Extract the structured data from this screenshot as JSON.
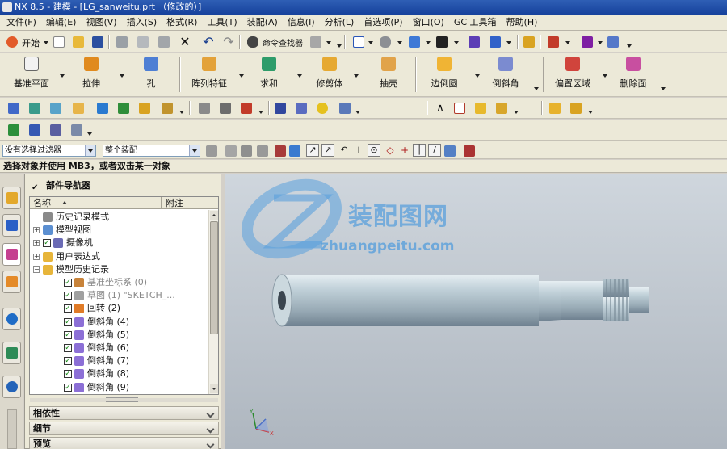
{
  "window": {
    "title": "NX 8.5 - 建模 - [LG_sanweitu.prt （修改的）]"
  },
  "menu": [
    "文件(F)",
    "编辑(E)",
    "视图(V)",
    "插入(S)",
    "格式(R)",
    "工具(T)",
    "装配(A)",
    "信息(I)",
    "分析(L)",
    "首选项(P)",
    "窗口(O)",
    "GC 工具箱",
    "帮助(H)"
  ],
  "standard_toolbar": {
    "start_label": "开始",
    "command_finder_label": "命令查找器"
  },
  "feature_toolbar": [
    {
      "label": "基准平面",
      "icon": "datum-plane-icon"
    },
    {
      "label": "拉伸",
      "icon": "extrude-icon"
    },
    {
      "label": "孔",
      "icon": "hole-icon"
    },
    {
      "label": "阵列特征",
      "icon": "pattern-feature-icon"
    },
    {
      "label": "求和",
      "icon": "unite-icon"
    },
    {
      "label": "修剪体",
      "icon": "trim-body-icon"
    },
    {
      "label": "抽壳",
      "icon": "shell-icon"
    },
    {
      "label": "边倒圆",
      "icon": "edge-blend-icon"
    },
    {
      "label": "倒斜角",
      "icon": "chamfer-icon"
    },
    {
      "label": "偏置区域",
      "icon": "offset-region-icon"
    },
    {
      "label": "删除面",
      "icon": "delete-face-icon"
    }
  ],
  "selection_bar": {
    "filter_value": "没有选择过滤器",
    "scope_value": "整个装配"
  },
  "cue_line": "选择对象并使用 MB3，或者双击某一对象",
  "part_navigator": {
    "title": "部件导航器",
    "columns": [
      "名称",
      "附注"
    ],
    "rows": [
      {
        "label": "历史记录模式",
        "level": 0,
        "expander": "",
        "checked": false,
        "icon": "clock-icon",
        "gray": false
      },
      {
        "label": "模型视图",
        "level": 0,
        "expander": "+",
        "checked": false,
        "icon": "model-view-icon",
        "gray": false
      },
      {
        "label": "摄像机",
        "level": 0,
        "expander": "+",
        "checked": true,
        "icon": "camera-icon",
        "gray": false
      },
      {
        "label": "用户表达式",
        "level": 0,
        "expander": "+",
        "checked": false,
        "icon": "folder-icon",
        "gray": false
      },
      {
        "label": "模型历史记录",
        "level": 0,
        "expander": "−",
        "checked": false,
        "icon": "folder-open-icon",
        "gray": false
      },
      {
        "label": "基准坐标系 (0)",
        "level": 1,
        "expander": "",
        "checked": true,
        "icon": "datum-csys-icon",
        "gray": true
      },
      {
        "label": "草图 (1) \"SKETCH_...",
        "level": 1,
        "expander": "",
        "checked": true,
        "icon": "sketch-icon",
        "gray": true
      },
      {
        "label": "回转 (2)",
        "level": 1,
        "expander": "",
        "checked": true,
        "icon": "revolve-icon",
        "gray": false
      },
      {
        "label": "倒斜角 (4)",
        "level": 1,
        "expander": "",
        "checked": true,
        "icon": "chamfer-icon",
        "gray": false
      },
      {
        "label": "倒斜角 (5)",
        "level": 1,
        "expander": "",
        "checked": true,
        "icon": "chamfer-icon",
        "gray": false
      },
      {
        "label": "倒斜角 (6)",
        "level": 1,
        "expander": "",
        "checked": true,
        "icon": "chamfer-icon",
        "gray": false
      },
      {
        "label": "倒斜角 (7)",
        "level": 1,
        "expander": "",
        "checked": true,
        "icon": "chamfer-icon",
        "gray": false
      },
      {
        "label": "倒斜角 (8)",
        "level": 1,
        "expander": "",
        "checked": true,
        "icon": "chamfer-icon",
        "gray": false
      },
      {
        "label": "倒斜角 (9)",
        "level": 1,
        "expander": "",
        "checked": true,
        "icon": "chamfer-icon",
        "gray": false
      }
    ],
    "panels": [
      "相依性",
      "细节",
      "预览"
    ]
  },
  "watermark": {
    "name": "装配图网",
    "url": "zhuangpeitu.com"
  },
  "triad_labels": {
    "x": "X",
    "y": "Y",
    "z": "Z"
  },
  "colors": {
    "titlebar": "#1f4ea8",
    "viewport_top": "#cfd6dd",
    "viewport_bottom": "#aeb6bf",
    "part_body": "#b3c3cc",
    "watermark": "#5aa0dc",
    "check_green": "#178a17"
  }
}
